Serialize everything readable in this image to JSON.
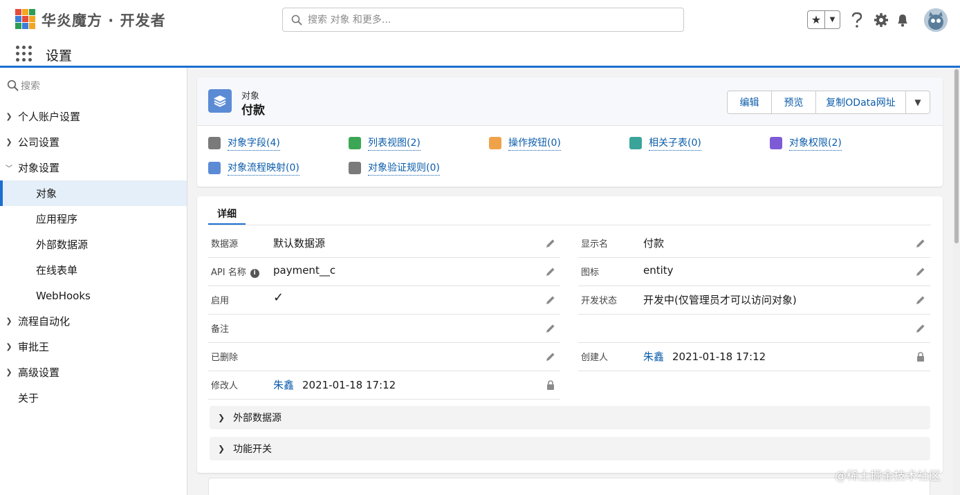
{
  "header": {
    "brand": "华炎魔方 · 开发者",
    "search_placeholder": "搜索 对象 和更多...",
    "app_title": "设置",
    "logo_colors": [
      "#e44c3c",
      "#f4a623",
      "#2d9d55",
      "#3b7fd9",
      "#e44c3c",
      "#f4a623",
      "#2d9d55",
      "#3b7fd9",
      "#f4a623"
    ]
  },
  "sidebar": {
    "search_placeholder": "搜索",
    "items": [
      {
        "label": "个人账户设置",
        "expandable": true
      },
      {
        "label": "公司设置",
        "expandable": true
      },
      {
        "label": "对象设置",
        "expandable": true,
        "expanded": true
      },
      {
        "label": "对象",
        "sub": true,
        "active": true
      },
      {
        "label": "应用程序",
        "sub": true
      },
      {
        "label": "外部数据源",
        "sub": true
      },
      {
        "label": "在线表单",
        "sub": true
      },
      {
        "label": "WebHooks",
        "sub": true
      },
      {
        "label": "流程自动化",
        "expandable": true
      },
      {
        "label": "审批王",
        "expandable": true
      },
      {
        "label": "高级设置",
        "expandable": true
      },
      {
        "label": "关于",
        "expandable": false
      }
    ]
  },
  "object_card": {
    "type_label": "对象",
    "name": "付款",
    "buttons": [
      "编辑",
      "预览",
      "复制OData网址"
    ],
    "related": [
      {
        "label": "对象字段(4)",
        "color": "#7a7a7a"
      },
      {
        "label": "列表视图(2)",
        "color": "#3ba755"
      },
      {
        "label": "操作按钮(0)",
        "color": "#f0a24a"
      },
      {
        "label": "相关子表(0)",
        "color": "#3ba49a"
      },
      {
        "label": "对象权限(2)",
        "color": "#7e5bd6"
      },
      {
        "label": "对象流程映射(0)",
        "color": "#5c8bd6"
      },
      {
        "label": "对象验证规则(0)",
        "color": "#7a7a7a"
      }
    ]
  },
  "detail": {
    "tab": "详细",
    "left_fields": [
      {
        "label": "数据源",
        "value": "默认数据源",
        "icon": "pencil-icon"
      },
      {
        "label": "API 名称",
        "value": "payment__c",
        "icon": "pencil-icon",
        "info": "i"
      },
      {
        "label": "启用",
        "value": "✓",
        "icon": "pencil-icon"
      },
      {
        "label": "备注",
        "value": "",
        "icon": "pencil-icon"
      },
      {
        "label": "已删除",
        "value": "",
        "icon": "pencil-icon"
      },
      {
        "label": "修改人",
        "link": "朱鑫",
        "value": "2021-01-18 17:12",
        "icon": "lock-icon"
      }
    ],
    "right_fields": [
      {
        "label": "显示名",
        "value": "付款",
        "icon": "pencil-icon"
      },
      {
        "label": "图标",
        "value": "entity",
        "icon": "pencil-icon"
      },
      {
        "label": "开发状态",
        "value": "开发中(仅管理员才可以访问对象)",
        "icon": "pencil-icon"
      },
      {
        "label": "",
        "value": "",
        "icon": "pencil-icon"
      },
      {
        "label": "创建人",
        "link": "朱鑫",
        "value": "2021-01-18 17:12",
        "icon": "lock-icon"
      }
    ],
    "sections": [
      "外部数据源",
      "功能开关"
    ]
  },
  "watermark": "@稀土掘金技术社区"
}
